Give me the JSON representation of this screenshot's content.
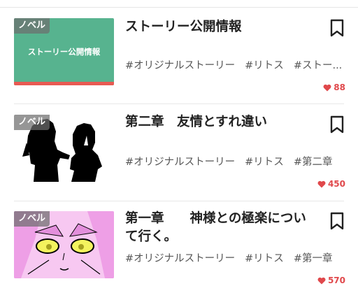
{
  "badge_label": "ノベル",
  "items": [
    {
      "title": "ストーリー公開情報",
      "thumb_caption": "ストーリー公開情報",
      "thumb_color": "#57b38f",
      "thumb_bar_color": "#e85a52",
      "tags": [
        "#オリジナルストーリー",
        "#リトス",
        "#ストー..."
      ],
      "likes": "88",
      "bookmark_icon": "bookmark-outline-icon",
      "heart_icon": "heart-icon"
    },
    {
      "title": "第二章　友情とすれ違い",
      "tags": [
        "#オリジナルストーリー",
        "#リトス",
        "#第二章"
      ],
      "likes": "450",
      "bookmark_icon": "bookmark-outline-icon",
      "heart_icon": "heart-icon"
    },
    {
      "title": "第一章　　神様との極楽について行く。",
      "title_line1": "第一章　　神様との極楽につい",
      "title_line2": "て行く。",
      "tags": [
        "#オリジナルストーリー",
        "#リトス",
        "#第一章"
      ],
      "likes": "570",
      "bookmark_icon": "bookmark-outline-icon",
      "heart_icon": "heart-icon"
    }
  ],
  "colors": {
    "like_red": "#e0484b",
    "text": "#222222",
    "tag_text": "#555555"
  }
}
